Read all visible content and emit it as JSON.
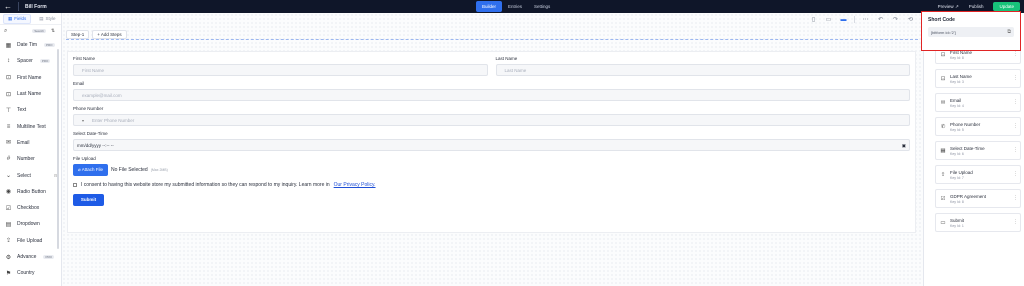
{
  "topbar": {
    "back_icon": "←",
    "form_title": "Bill Form",
    "tabs": [
      "Builder",
      "Entries",
      "Settings"
    ],
    "active_tab": "Builder",
    "preview_label": "Preview",
    "preview_icon": "↗",
    "publish_label": "Publish",
    "update_label": "Update"
  },
  "leftpanel": {
    "tabs": [
      "Fields",
      "Style"
    ],
    "search_icon": "⌕",
    "search_badge": "Search",
    "items": [
      {
        "label": "Date Tim",
        "icon": "▦",
        "pro": "PRO"
      },
      {
        "label": "Spacer",
        "icon": "↕",
        "pro": "PRO"
      },
      {
        "label": "First Name",
        "icon": "⊡",
        "pro": ""
      },
      {
        "label": "Last Name",
        "icon": "⊡",
        "pro": ""
      },
      {
        "label": "Text",
        "icon": "⊤",
        "pro": ""
      },
      {
        "label": "Multiline Text",
        "icon": "≡",
        "pro": ""
      },
      {
        "label": "Email",
        "icon": "✉",
        "pro": ""
      },
      {
        "label": "Number",
        "icon": "#",
        "pro": ""
      },
      {
        "label": "Select",
        "icon": "⌄",
        "pro": ""
      },
      {
        "label": "Radio Button",
        "icon": "◉",
        "pro": ""
      },
      {
        "label": "Checkbox",
        "icon": "☑",
        "pro": ""
      },
      {
        "label": "Dropdown",
        "icon": "▤",
        "pro": ""
      },
      {
        "label": "File Upload",
        "icon": "⇪",
        "pro": ""
      },
      {
        "label": "Advance",
        "icon": "⚙",
        "pro": "PRO"
      },
      {
        "label": "Country",
        "icon": "⚑",
        "pro": ""
      }
    ]
  },
  "toolbar": {
    "icons": [
      "mobile-icon",
      "tablet-icon",
      "desktop-icon",
      "more-icon",
      "undo-icon",
      "redo-icon",
      "history-icon"
    ]
  },
  "steps": {
    "step_label": "Step-1",
    "add_label": "+ Add Steps"
  },
  "form": {
    "first_name": {
      "label": "First Name",
      "placeholder": "First Name"
    },
    "last_name": {
      "label": "Last Name",
      "placeholder": "Last Name"
    },
    "email": {
      "label": "Email",
      "placeholder": "example@mail.com"
    },
    "phone": {
      "label": "Phone Number",
      "placeholder": "Enter Phone Number"
    },
    "datetime": {
      "label": "Select Date-Time",
      "placeholder": "mm/dd/yyyy --:-- --"
    },
    "upload": {
      "label": "File Upload",
      "button": "Attach File",
      "no_file": "No File Selected",
      "max": "(Max 2MB)"
    },
    "consent": {
      "text": "I consent to having this website store my submitted information so they can respond to my inquiry. Learn more in",
      "link": "Our Privacy Policy."
    },
    "submit_label": "Submit"
  },
  "rightpanel": {
    "items": [
      {
        "name": "First Name",
        "key": "Key Id: 8"
      },
      {
        "name": "Last Name",
        "key": "Key Id: 3"
      },
      {
        "name": "Email",
        "key": "Key Id: 4"
      },
      {
        "name": "Phone Number",
        "key": "Key Id: 5"
      },
      {
        "name": "Select Date-Time",
        "key": "Key Id: 6"
      },
      {
        "name": "File Upload",
        "key": "Key Id: 7"
      },
      {
        "name": "GDPR Agreement",
        "key": "Key Id: 8"
      },
      {
        "name": "Submit",
        "key": "Key Id: 1"
      }
    ]
  },
  "shortcode": {
    "title": "Short Code",
    "code": "[bitform id='2']"
  }
}
